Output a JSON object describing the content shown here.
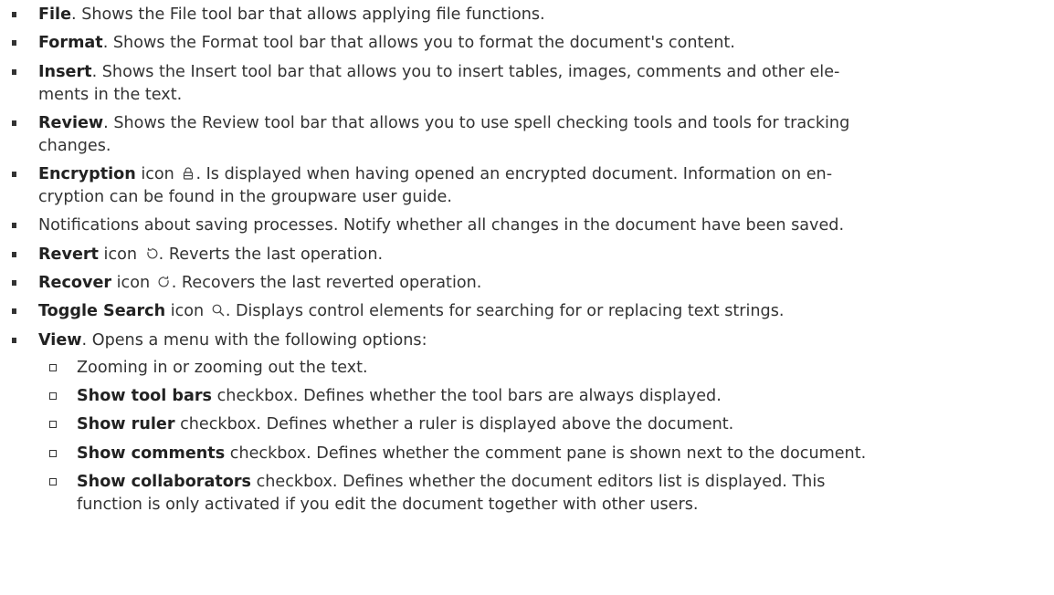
{
  "items": [
    {
      "title": "File",
      "text": ". Shows the File tool bar that allows applying file functions."
    },
    {
      "title": "Format",
      "text": ". Shows the Format tool bar that allows you to format the document's content."
    },
    {
      "title": "Insert",
      "text": ". Shows the Insert tool bar that allows you to insert tables, images, comments and other ele-",
      "text2": "ments in the text."
    },
    {
      "title": "Review",
      "text": ". Shows the Review tool bar that allows you to use spell checking tools and tools for tracking",
      "text2": "changes."
    },
    {
      "title": "Encryption",
      "pre_icon": " icon ",
      "icon": "lock-icon",
      "text": ". Is displayed when having opened an encrypted document. Information on en-",
      "text2": "cryption can be found in the groupware user guide."
    },
    {
      "text": "Notifications about saving processes. Notify whether all changes in the document have been saved."
    },
    {
      "title": "Revert",
      "pre_icon": " icon ",
      "icon": "undo-icon",
      "text": ". Reverts the last operation."
    },
    {
      "title": "Recover",
      "pre_icon": " icon ",
      "icon": "redo-icon",
      "text": ". Recovers the last reverted operation."
    },
    {
      "title": "Toggle Search",
      "pre_icon": " icon ",
      "icon": "search-icon",
      "text": ". Displays control elements for searching for or replacing text strings."
    },
    {
      "title": "View",
      "text": ". Opens a menu with the following options:"
    }
  ],
  "view_options": [
    {
      "text": "Zooming in or zooming out the text."
    },
    {
      "title": "Show tool bars",
      "text": " checkbox. Defines whether the tool bars are always displayed."
    },
    {
      "title": "Show ruler",
      "text": " checkbox. Defines whether a ruler is displayed above the document."
    },
    {
      "title": "Show comments",
      "text": " checkbox. Defines whether the comment pane is shown next to the document."
    },
    {
      "title": "Show collaborators",
      "text": " checkbox. Defines whether the document editors list is displayed. This",
      "text2": "function is only activated if you edit the document together with other users."
    }
  ],
  "colors": {
    "text": "#333333",
    "background": "#ffffff"
  }
}
